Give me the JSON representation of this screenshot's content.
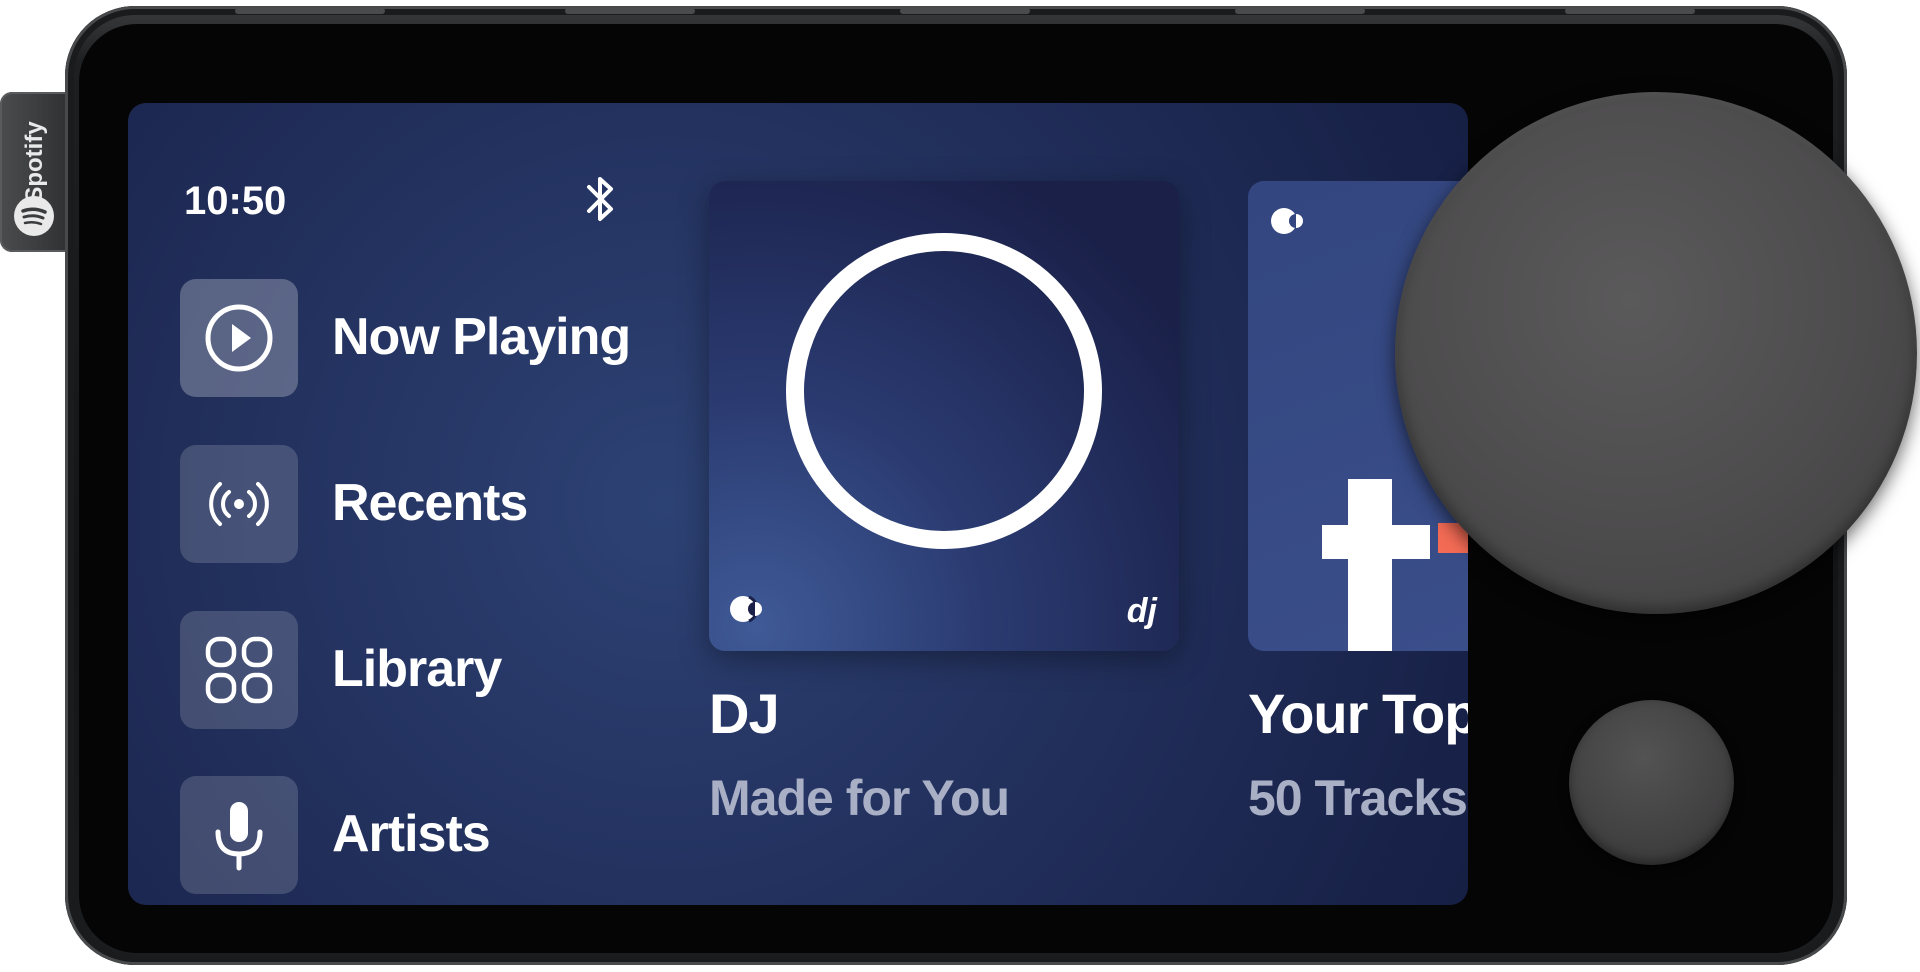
{
  "brand": {
    "name": "Spotify"
  },
  "status": {
    "time": "10:50",
    "bluetooth_icon": "bluetooth-icon"
  },
  "nav": {
    "items": [
      {
        "label": "Now Playing",
        "icon": "play-circle-icon",
        "active": true
      },
      {
        "label": "Recents",
        "icon": "broadcast-icon",
        "active": false
      },
      {
        "label": "Library",
        "icon": "grid-icon",
        "active": false
      },
      {
        "label": "Artists",
        "icon": "microphone-icon",
        "active": false
      }
    ]
  },
  "cards": [
    {
      "title": "DJ",
      "subtitle": "Made for You",
      "badge": "dj",
      "art": "dj-ring-art"
    },
    {
      "title": "Your Top",
      "subtitle": "50 Tracks",
      "art": "top-tracks-art"
    }
  ],
  "colors": {
    "screen_bg": "#23315e",
    "tile_bg": "#ffffff29",
    "subtitle": "#a9b0c6",
    "accent_orange": "#f36b55",
    "knob": "#4d4c4d"
  }
}
